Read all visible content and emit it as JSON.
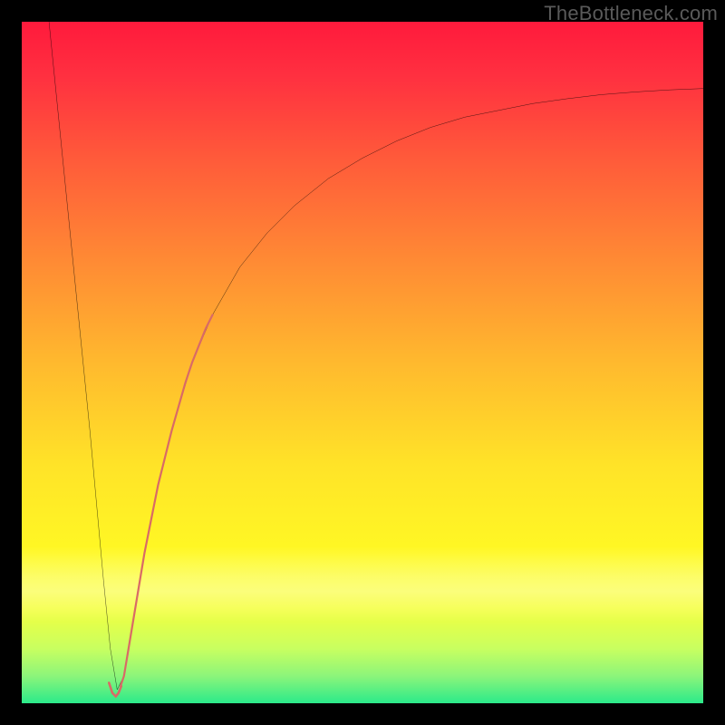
{
  "watermark": "TheBottleneck.com",
  "chart_data": {
    "type": "line",
    "title": "",
    "xlabel": "",
    "ylabel": "",
    "xlim": [
      0,
      100
    ],
    "ylim": [
      0,
      100
    ],
    "grid": false,
    "legend": false,
    "notes": "Axes unlabeled; values are percentage of plot area. y=0 at bottom (green), y=100 at top (red). Curve plunges from top-left to a minimum near x≈14 then rises asymptotically toward y≈90.",
    "series": [
      {
        "name": "main-curve",
        "color": "#000000",
        "x": [
          4,
          6,
          8,
          10,
          12,
          13,
          14,
          15,
          16,
          18,
          20,
          22,
          25,
          28,
          32,
          36,
          40,
          45,
          50,
          55,
          60,
          65,
          70,
          75,
          80,
          85,
          90,
          95,
          100
        ],
        "y": [
          100,
          80,
          60,
          40,
          18,
          8,
          2,
          4,
          10,
          22,
          32,
          40,
          50,
          57,
          64,
          69,
          73,
          77,
          80,
          82.5,
          84.5,
          86,
          87,
          88,
          88.7,
          89.3,
          89.7,
          90,
          90.2
        ]
      },
      {
        "name": "highlight-segment",
        "color": "#d96a66",
        "x": [
          14.5,
          15,
          16,
          17,
          18,
          19,
          20,
          21,
          22,
          23,
          24,
          25,
          26,
          27,
          28
        ],
        "y": [
          2.5,
          4,
          10,
          16,
          22,
          27,
          32,
          36,
          40,
          43.5,
          47,
          50,
          52.5,
          55,
          57
        ]
      },
      {
        "name": "highlight-hook",
        "color": "#d96a66",
        "x": [
          12.8,
          13.3,
          13.8,
          14.2,
          14.6
        ],
        "y": [
          3.0,
          1.5,
          1.0,
          1.5,
          2.5
        ]
      }
    ],
    "background_gradient": {
      "top": "#ff1a3c",
      "middle": "#ffe328",
      "bottom": "#2bea8a"
    }
  }
}
